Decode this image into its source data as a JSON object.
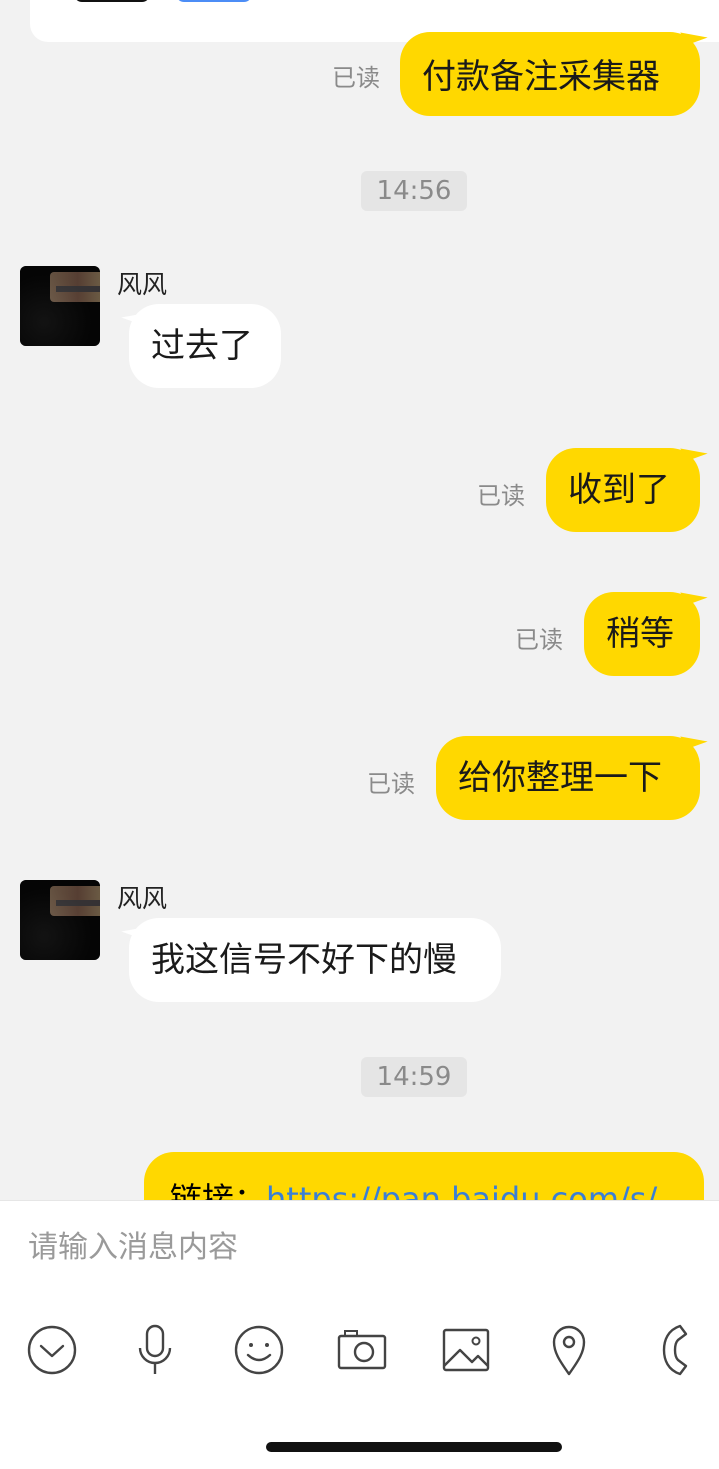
{
  "messages": {
    "partial_top": {
      "read": "已读",
      "text": "付款备注采集器"
    },
    "time1": "14:56",
    "m1": {
      "sender": "风风",
      "text": "过去了"
    },
    "m2": {
      "read": "已读",
      "text": "收到了"
    },
    "m3": {
      "read": "已读",
      "text": "稍等"
    },
    "m4": {
      "read": "已读",
      "text": "给你整理一下"
    },
    "m5": {
      "sender": "风风",
      "text": "我这信号不好下的慢"
    },
    "time2": "14:59",
    "m6": {
      "label": "链接：",
      "link": "https://pan.baidu.com/s/"
    }
  },
  "composer": {
    "placeholder": "请输入消息内容",
    "tools": [
      "chevron-down-icon",
      "microphone-icon",
      "emoji-icon",
      "camera-icon",
      "image-icon",
      "location-icon",
      "phone-icon"
    ]
  },
  "colors": {
    "own_bubble": "#ffd800",
    "peer_bubble": "#ffffff",
    "background": "#f2f2f2",
    "link": "#3a7fd5"
  }
}
